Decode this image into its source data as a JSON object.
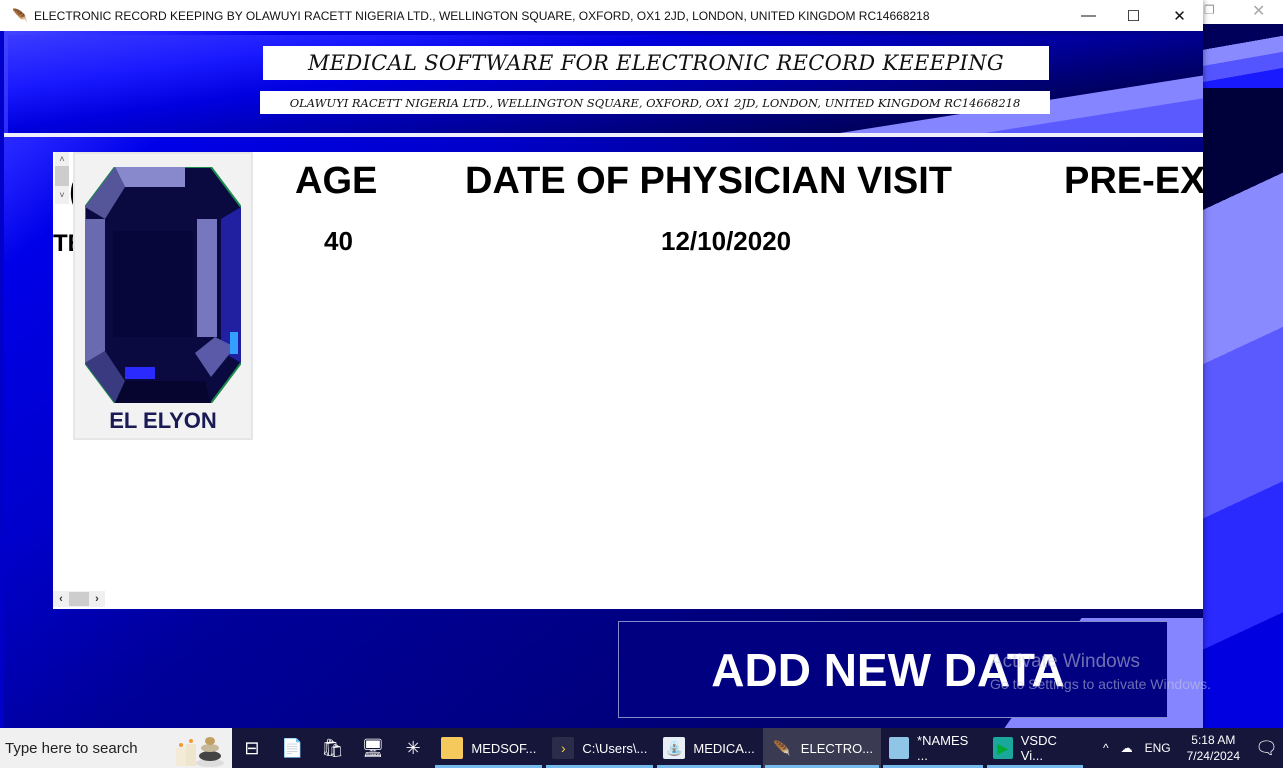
{
  "window": {
    "title": "ELECTRONIC RECORD KEEPING BY OLAWUYI RACETT NIGERIA LTD., WELLINGTON SQUARE, OXFORD, OX1 2JD, LONDON, UNITED KINGDOM RC14668218",
    "controls": {
      "minimize": "—",
      "maximize": "☐",
      "close": "✕"
    }
  },
  "banner": {
    "title": "MEDICAL SOFTWARE FOR ELECTRONIC RECORD KEEEPING",
    "subtitle": "OLAWUYI RACETT NIGERIA LTD., WELLINGTON SQUARE, OXFORD, OX1 2JD, LONDON, UNITED KINGDOM RC14668218"
  },
  "records": {
    "cut_header": "(",
    "cut_value": "TE",
    "photo_name": "EL ELYON",
    "columns": [
      "AGE",
      "DATE OF PHYSICIAN VISIT",
      "PRE-EX"
    ],
    "row": {
      "age": "40",
      "date_of_physician_visit": "12/10/2020"
    },
    "scroll": {
      "up": "˄",
      "down": "˅",
      "left": "‹",
      "right": "›"
    }
  },
  "actions": {
    "add_new_data": "ADD NEW DATA"
  },
  "watermark": {
    "line1": "Activate Windows",
    "line2": "Go to Settings to activate Windows."
  },
  "taskbar": {
    "search_placeholder": "Type here to search",
    "apps": [
      {
        "label": "MEDSOF...",
        "icon": "folder-icon"
      },
      {
        "label": "C:\\Users\\...",
        "icon": "python-console-icon"
      },
      {
        "label": "MEDICA...",
        "icon": "medical-app-icon"
      },
      {
        "label": "ELECTRO...",
        "icon": "feather-icon",
        "active": true
      },
      {
        "label": "*NAMES ...",
        "icon": "notepad-icon"
      },
      {
        "label": "VSDC Vi...",
        "icon": "vsdc-icon"
      }
    ],
    "tray": {
      "chevron": "^",
      "language": "ENG"
    },
    "clock": {
      "time": "5:18 AM",
      "date": "7/24/2024"
    }
  },
  "colors": {
    "accent": "#0000c8",
    "button_bg": "#000080",
    "taskbar": "#16163a"
  }
}
